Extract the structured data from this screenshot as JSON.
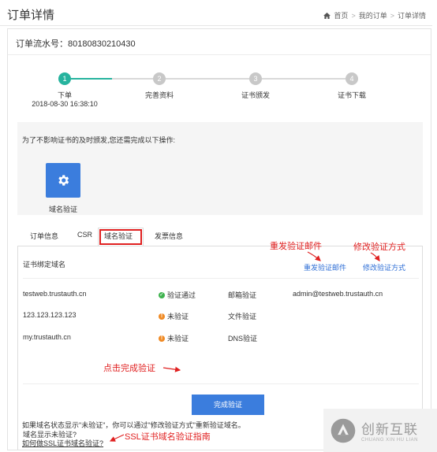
{
  "header": {
    "title": "订单详情",
    "breadcrumb": [
      "首页",
      "我的订单",
      "订单详情"
    ],
    "separator": ">"
  },
  "order": {
    "serial_label": "订单流水号：80180830210430"
  },
  "steps": [
    {
      "number": "1",
      "label": "下单",
      "time": "2018-08-30 16:38:10",
      "state": "done"
    },
    {
      "number": "2",
      "label": "完善资料",
      "state": "pending"
    },
    {
      "number": "3",
      "label": "证书颁发",
      "state": "pending"
    },
    {
      "number": "4",
      "label": "证书下载",
      "state": "pending"
    }
  ],
  "notice": {
    "text": "为了不影响证书的及时颁发,您还需完成以下操作:",
    "action_label": "域名验证",
    "action_icon": "gear-icon"
  },
  "tabs": [
    {
      "label": "订单信息"
    },
    {
      "label": "CSR"
    },
    {
      "label": "域名验证",
      "active": true
    },
    {
      "label": "发票信息"
    }
  ],
  "verification": {
    "title": "证书绑定域名",
    "resend_link": "重发验证邮件",
    "change_method_link": "修改验证方式",
    "rows": [
      {
        "domain": "testweb.trustauth.cn",
        "status": "验证通过",
        "status_type": "ok",
        "method": "邮箱验证",
        "email": "admin@testweb.trustauth.cn"
      },
      {
        "domain": "123.123.123.123",
        "status": "未验证",
        "status_type": "warn",
        "method": "文件验证",
        "email": ""
      },
      {
        "domain": "my.trustauth.cn",
        "status": "未验证",
        "status_type": "warn",
        "method": "DNS验证",
        "email": ""
      }
    ],
    "complete_button": "完成验证",
    "faq_title": "域名显示未验证?",
    "faq_text": "如果域名状态显示\"未验证\"，你可以通过\"修改验证方式\"重新验证域名。",
    "guide_link": "如何做SSL证书域名验证?"
  },
  "annotations": {
    "resend": "重发验证邮件",
    "change": "修改验证方式",
    "complete": "点击完成验证",
    "guide": "SSL证书域名验证指南"
  },
  "watermark": {
    "main": "创新互联",
    "sub": "CHUANG XIN HU LIAN"
  },
  "colors": {
    "primary": "#3b7ddd",
    "teal": "#26b39e",
    "step_gray": "#c8c8c8",
    "ok_green": "#3fb34f",
    "warn_orange": "#f08a24",
    "annotation_red": "#e02020",
    "link_blue": "#2f6fd6"
  }
}
